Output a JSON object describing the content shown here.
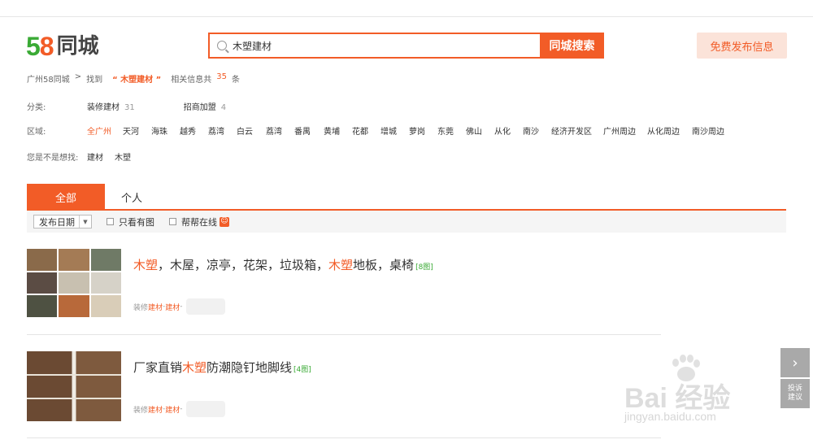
{
  "header": {
    "logo_num1": "5",
    "logo_num2": "8",
    "logo_text": "同城",
    "search_value": "木塑建材",
    "search_button": "同城搜索",
    "publish_button": "免费发布信息"
  },
  "breadcrumb": {
    "site": "广州58同城",
    "sep": ">",
    "found": "找到",
    "keyword": "“ 木塑建材 ”",
    "related_prefix": "相关信息共",
    "count": "35",
    "unit": "条"
  },
  "filters": {
    "category_label": "分类:",
    "categories": [
      {
        "name": "装修建材",
        "count": "31"
      },
      {
        "name": "招商加盟",
        "count": "4"
      }
    ],
    "area_label": "区域:",
    "areas": [
      "全广州",
      "天河",
      "海珠",
      "越秀",
      "荔湾",
      "白云",
      "荔湾",
      "番禺",
      "黄埔",
      "花都",
      "增城",
      "萝岗",
      "东莞",
      "佛山",
      "从化",
      "南沙",
      "经济开发区",
      "广州周边",
      "从化周边",
      "南沙周边"
    ],
    "guess_label": "您是不是想找:",
    "guesses": [
      "建材",
      "木塑"
    ]
  },
  "tabs": {
    "all": "全部",
    "personal": "个人"
  },
  "toolbar": {
    "sort": "发布日期",
    "only_pics": "只看有图",
    "online": "帮帮在线"
  },
  "listings": [
    {
      "title_parts": [
        "木塑",
        "，木屋，凉亭，花架，垃圾箱，",
        "木塑",
        "地板，桌椅"
      ],
      "pic_count": "[8图]",
      "meta_cat": "装修",
      "meta_cat2": "建材",
      "meta_sep": " - ",
      "meta_sub": "建材"
    },
    {
      "title_parts": [
        "厂家直销",
        "木塑",
        "防潮隐钉地脚线"
      ],
      "pic_count": "[4图]",
      "meta_cat": "装修",
      "meta_cat2": "建材",
      "meta_sep": " - ",
      "meta_sub": "建材"
    }
  ],
  "float": {
    "next_icon": "chevron-right-icon",
    "report_line1": "投诉",
    "report_line2": "建议"
  },
  "watermark": {
    "main": "Bai 经验",
    "sub": "jingyan.baidu.com"
  },
  "colors": {
    "accent": "#f25c27",
    "green": "#3aaa35"
  }
}
